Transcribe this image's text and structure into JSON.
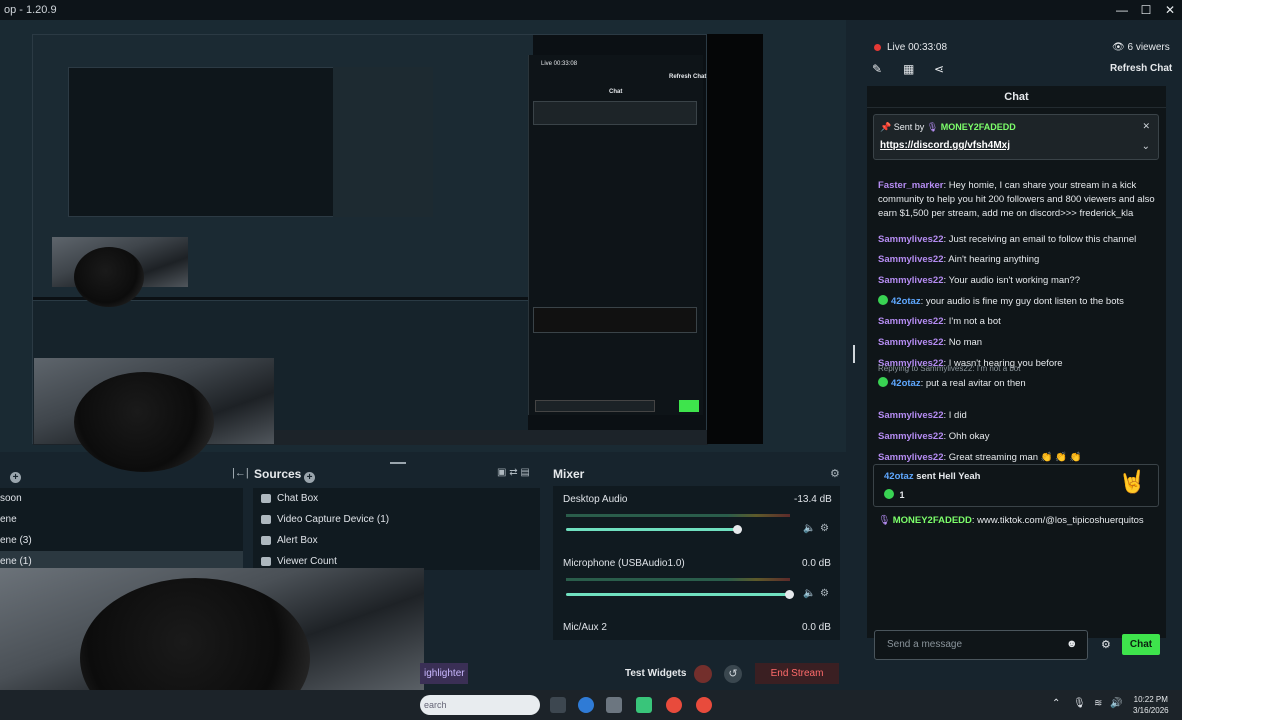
{
  "window": {
    "title": "op - 1.20.9",
    "controls": [
      "—",
      "☐",
      "✕"
    ],
    "expand_arrow": "›"
  },
  "preview": {
    "nested_caption": "Live 00:33:08",
    "nested_chat_header": "Chat",
    "nested_refresh": "Refresh Chat"
  },
  "scenes": {
    "items": [
      "soon",
      "ene",
      "ene (3)",
      "ene (1)"
    ],
    "selected_index": 3
  },
  "sources": {
    "title": "Sources",
    "items": [
      "Chat Box",
      "Video Capture Device (1)",
      "Alert Box",
      "Viewer Count"
    ]
  },
  "mixer": {
    "title": "Mixer",
    "channels": [
      {
        "name": "Desktop Audio",
        "db": "-13.4 dB",
        "level": 0.77
      },
      {
        "name": "Microphone (USBAudio1.0)",
        "db": "0.0 dB",
        "level": 1.0
      },
      {
        "name": "Mic/Aux 2",
        "db": "0.0 dB",
        "level": 0
      }
    ]
  },
  "footer": {
    "highlighter": "ighlighter",
    "test_widgets": "Test Widgets",
    "end_stream": "End Stream"
  },
  "taskbar": {
    "search": "earch",
    "time": "10:22 PM",
    "date": "3/16/2026"
  },
  "stream": {
    "live_label": "Live 00:33:08",
    "viewers": "6 viewers",
    "refresh": "Refresh Chat"
  },
  "chat": {
    "title": "Chat",
    "pinned": {
      "sent_by": "Sent by",
      "user": "MONEY2FADEDD",
      "link": "https://discord.gg/vfsh4Mxj"
    },
    "messages": [
      {
        "user": "Faster_marker",
        "text": "Hey homie, I can share your stream in a kick community to help you hit 200 followers and 800 viewers and also earn $1,500 per stream, add me on discord>>> frederick_kla",
        "color": "purple"
      },
      {
        "user": "Sammylives22",
        "text": "Just receiving an email to follow this channel",
        "color": "purple"
      },
      {
        "user": "Sammylives22",
        "text": "Ain't hearing anything",
        "color": "purple"
      },
      {
        "user": "Sammylives22",
        "text": "Your audio isn't working man??",
        "color": "purple"
      },
      {
        "user": "42otaz",
        "text": "your audio is fine my guy dont listen to the bots",
        "color": "blue"
      },
      {
        "user": "Sammylives22",
        "text": "I'm not a bot",
        "color": "purple"
      },
      {
        "user": "Sammylives22",
        "text": "No man",
        "color": "purple"
      },
      {
        "user": "Sammylives22",
        "text": "I wasn't hearing you before",
        "color": "purple"
      },
      {
        "user": "42otaz",
        "text": "put a real avitar on then",
        "color": "blue",
        "reply": "Replying to Sammylives22: I'm not a bot"
      },
      {
        "user": "Sammylives22",
        "text": "I did",
        "color": "purple"
      },
      {
        "user": "Sammylives22",
        "text": "Ohh okay",
        "color": "purple"
      },
      {
        "user": "Sammylives22",
        "text": "Great streaming man 👏 👏 👏",
        "color": "purple"
      }
    ],
    "tip": {
      "user": "42otaz",
      "text": "sent Hell Yeah",
      "amount": "1",
      "emoji": "🤘"
    },
    "last_message": {
      "user": "MONEY2FADEDD",
      "text": "www.tiktok.com/@los_tipicoshuerquitos"
    },
    "input_placeholder": "Send a message",
    "send_label": "Chat"
  }
}
